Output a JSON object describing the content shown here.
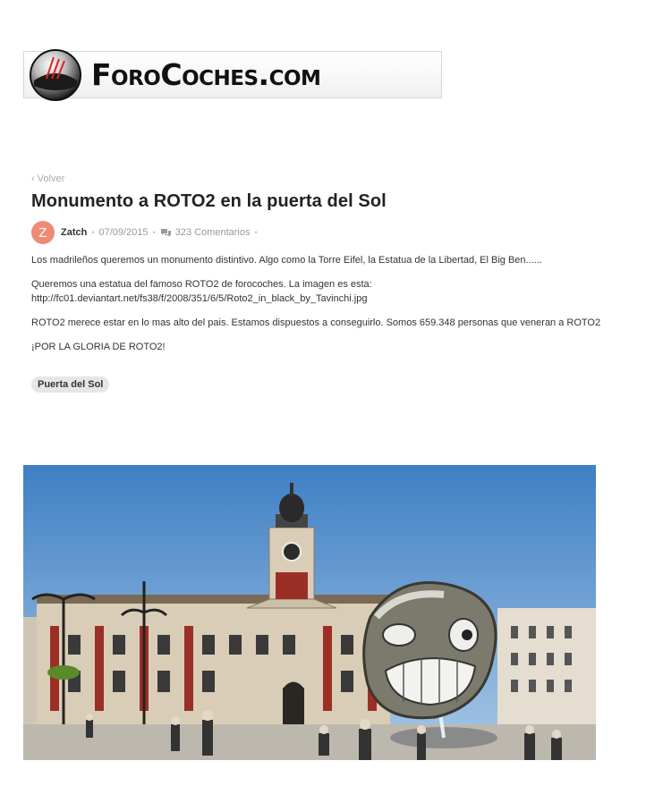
{
  "site": {
    "logo_text": "ForoCoches.com"
  },
  "article": {
    "back_label": "Volver",
    "title": "Monumento a ROTO2 en la puerta del Sol",
    "author_initial": "Z",
    "author": "Zatch",
    "date": "07/09/2015",
    "comments": "323 Comentarios",
    "paragraphs": [
      "Los madrileños queremos un monumento distintivo. Algo como la Torre Eifel, la Estatua de la Libertad, El Big Ben......",
      "Queremos una estatua del famoso ROTO2 de forocoches. La imagen es esta:",
      "http://fc01.deviantart.net/fs38/f/2008/351/6/5/Roto2_in_black_by_Tavinchi.jpg",
      "ROTO2 merece estar en lo mas alto del pais. Estamos dispuestos a conseguirlo. Somos 659.348 personas que veneran a ROTO2",
      "¡POR LA GLORIA DE ROTO2!"
    ],
    "tag": "Puerta del Sol"
  },
  "colors": {
    "avatar": "#ee8b76",
    "tag_bg": "#e6e6e6",
    "muted_text": "#a8a8a8"
  },
  "icons": {
    "back": "chevron-left-icon",
    "comments": "comments-icon"
  }
}
